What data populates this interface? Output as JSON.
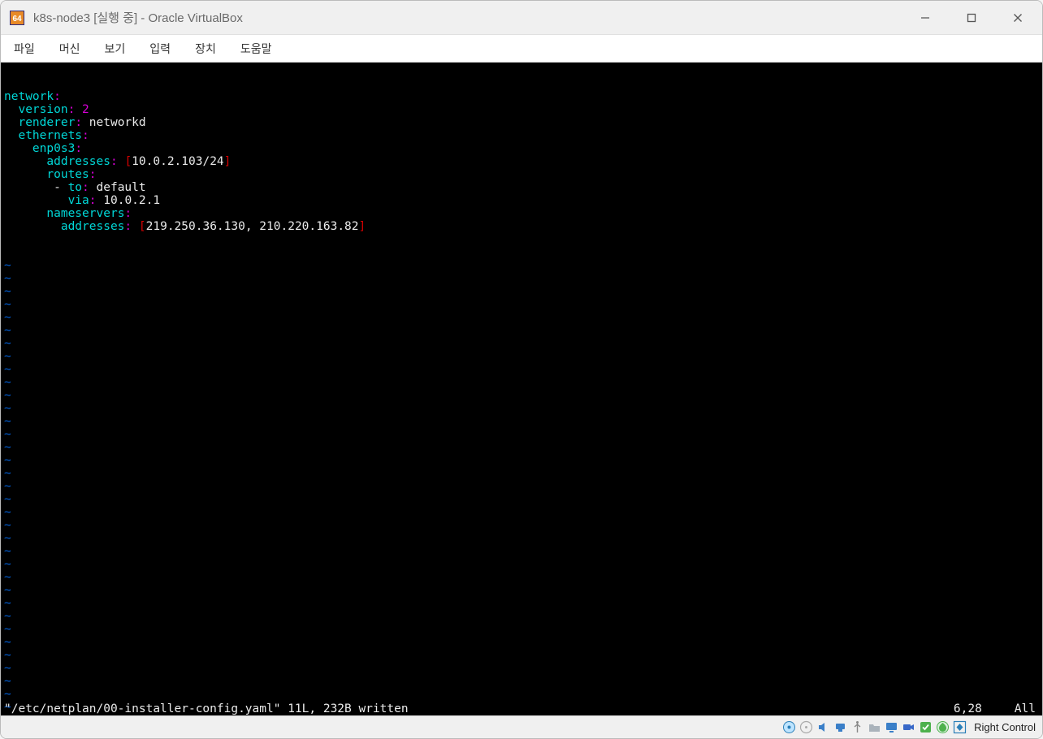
{
  "window": {
    "title": "k8s-node3 [실행 중] - Oracle VirtualBox"
  },
  "menubar": {
    "items": [
      "파일",
      "머신",
      "보기",
      "입력",
      "장치",
      "도움말"
    ]
  },
  "editor": {
    "lines": [
      [
        {
          "t": "network",
          "c": "cyan"
        },
        {
          "t": ":",
          "c": "magenta"
        }
      ],
      [
        {
          "t": "  ",
          "c": "white"
        },
        {
          "t": "version",
          "c": "cyan"
        },
        {
          "t": ": ",
          "c": "magenta"
        },
        {
          "t": "2",
          "c": "magenta"
        }
      ],
      [
        {
          "t": "  ",
          "c": "white"
        },
        {
          "t": "renderer",
          "c": "cyan"
        },
        {
          "t": ": ",
          "c": "magenta"
        },
        {
          "t": "networkd",
          "c": "white"
        }
      ],
      [
        {
          "t": "  ",
          "c": "white"
        },
        {
          "t": "ethernets",
          "c": "cyan"
        },
        {
          "t": ":",
          "c": "magenta"
        }
      ],
      [
        {
          "t": "    ",
          "c": "white"
        },
        {
          "t": "enp0s3",
          "c": "cyan"
        },
        {
          "t": ":",
          "c": "magenta"
        }
      ],
      [
        {
          "t": "      ",
          "c": "white"
        },
        {
          "t": "addresses",
          "c": "cyan"
        },
        {
          "t": ": ",
          "c": "magenta"
        },
        {
          "t": "[",
          "c": "red"
        },
        {
          "t": "10.0.2.103/24",
          "c": "white"
        },
        {
          "t": "]",
          "c": "red"
        }
      ],
      [
        {
          "t": "      ",
          "c": "white"
        },
        {
          "t": "routes",
          "c": "cyan"
        },
        {
          "t": ":",
          "c": "magenta"
        }
      ],
      [
        {
          "t": "       - ",
          "c": "white"
        },
        {
          "t": "to",
          "c": "cyan"
        },
        {
          "t": ": ",
          "c": "magenta"
        },
        {
          "t": "default",
          "c": "white"
        }
      ],
      [
        {
          "t": "         ",
          "c": "white"
        },
        {
          "t": "via",
          "c": "cyan"
        },
        {
          "t": ": ",
          "c": "magenta"
        },
        {
          "t": "10.0.2.1",
          "c": "white"
        }
      ],
      [
        {
          "t": "      ",
          "c": "white"
        },
        {
          "t": "nameservers",
          "c": "cyan"
        },
        {
          "t": ":",
          "c": "magenta"
        }
      ],
      [
        {
          "t": "        ",
          "c": "white"
        },
        {
          "t": "addresses",
          "c": "cyan"
        },
        {
          "t": ": ",
          "c": "magenta"
        },
        {
          "t": "[",
          "c": "red"
        },
        {
          "t": "219.250.36.130, 210.220.163.82",
          "c": "white"
        },
        {
          "t": "]",
          "c": "red"
        }
      ]
    ],
    "tilde_count": 37,
    "status_left": "\"/etc/netplan/00-installer-config.yaml\" 11L, 232B written",
    "status_pos": "6,28",
    "status_pct": "All"
  },
  "statusbar": {
    "host_key": "Right Control"
  }
}
